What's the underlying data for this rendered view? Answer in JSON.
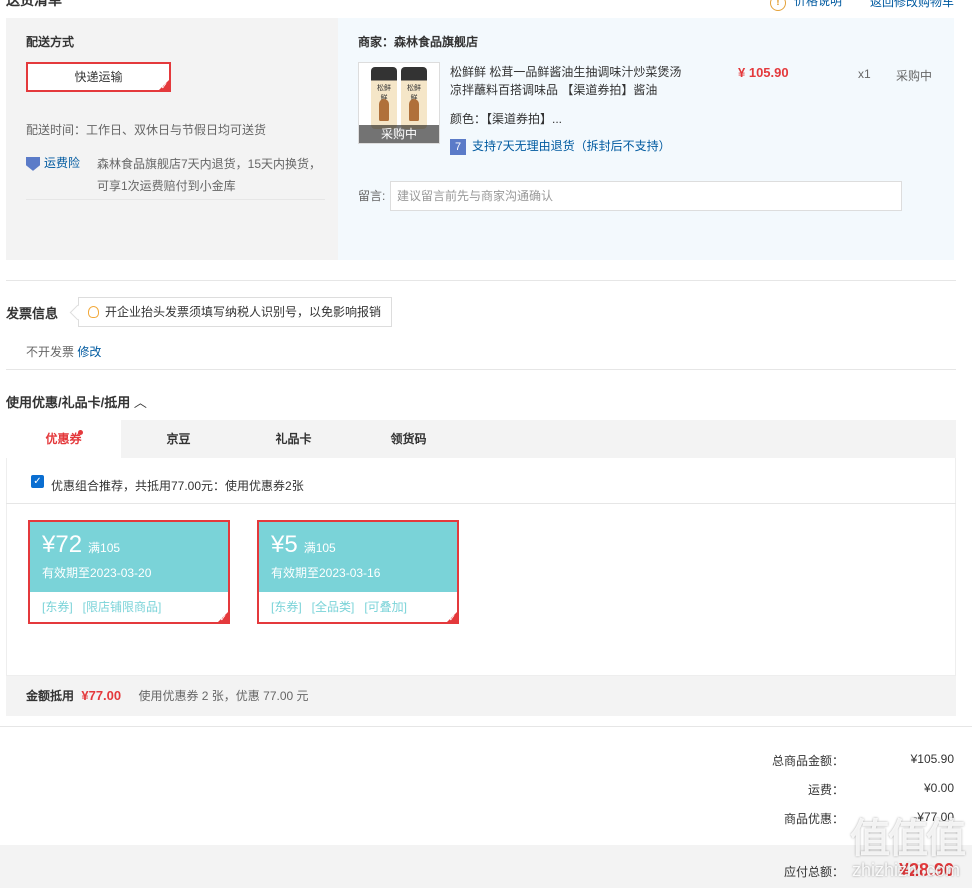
{
  "header": {
    "title": "送货清单",
    "price_note": "价格说明",
    "back_to_cart": "返回修改购物车"
  },
  "shipping": {
    "method_label": "配送方式",
    "method_value": "快递运输",
    "time_text": "配送时间：工作日、双休日与节假日均可送货",
    "insurance_label": "运费险",
    "insurance_line1": "森林食品旗舰店7天内退货，15天内换货，",
    "insurance_line2": "可享1次运费赔付到小金库"
  },
  "order": {
    "merchant": "商家：森林食品旗舰店",
    "image_badge": "采购中",
    "bottle_label": "松鲜鲜",
    "title_line1": "松鲜鲜 松茸一品鲜酱油生抽调味汁炒菜煲汤",
    "title_line2": "凉拌蘸料百搭调味品 【渠道券拍】酱油",
    "price": "¥ 105.90",
    "qty": "x1",
    "status": "采购中",
    "color": "颜色：【渠道券拍】...",
    "return_icon": "7",
    "return_text": "支持7天无理由退货（拆封后不支持）",
    "note_label": "留言:",
    "note_placeholder": "建议留言前先与商家沟通确认"
  },
  "invoice": {
    "title": "发票信息",
    "tip": "开企业抬头发票须填写纳税人识别号，以免影响报销",
    "status": "不开发票",
    "modify": "修改"
  },
  "discount": {
    "title": "使用优惠/礼品卡/抵用",
    "tabs": [
      "优惠券",
      "京豆",
      "礼品卡",
      "领货码"
    ],
    "recommend": "优惠组合推荐，共抵用77.00元：使用优惠券2张",
    "coupons": [
      {
        "amount": "¥72",
        "cond": "满105",
        "expiry": "有效期至2023-03-20",
        "tag1": "[东券]",
        "tag2": "[限店铺限商品]",
        "tag3": ""
      },
      {
        "amount": "¥5",
        "cond": "满105",
        "expiry": "有效期至2023-03-16",
        "tag1": "[东券]",
        "tag2": "[全品类]",
        "tag3": "[可叠加]"
      }
    ],
    "summary_label": "金额抵用",
    "summary_amount": "¥77.00",
    "summary_desc": "使用优惠券 2 张，优惠 77.00 元"
  },
  "totals": {
    "goods_label": "总商品金额：",
    "goods_value": "¥105.90",
    "freight_label": "运费：",
    "freight_value": "¥0.00",
    "promo_label": "商品优惠：",
    "promo_value": "-¥77.00",
    "payable_label": "应付总额：",
    "payable_value": "¥28.90"
  },
  "watermark": {
    "logo": "值值值",
    "site": "zhizhizhi.com"
  },
  "colors": {
    "accent": "#e4393c",
    "coupon": "#7ad3d8",
    "link": "#005aa0"
  }
}
